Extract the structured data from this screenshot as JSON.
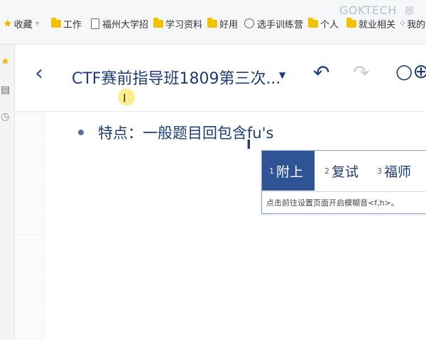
{
  "bookmarks": {
    "items": [
      {
        "label": "收藏",
        "icon": "star-icon"
      },
      {
        "label": "工作",
        "icon": "folder-icon"
      },
      {
        "label": "福州大学招",
        "icon": "page-icon"
      },
      {
        "label": "学习资料",
        "icon": "folder-icon"
      },
      {
        "label": "好用",
        "icon": "folder-icon"
      },
      {
        "label": "选手训练营",
        "icon": "circle-icon"
      },
      {
        "label": "个人",
        "icon": "folder-icon"
      },
      {
        "label": "就业相关",
        "icon": "folder-icon"
      },
      {
        "label": "我的",
        "icon": "dots-icon"
      }
    ],
    "watermark": "GOKTECH",
    "watermark_extra": "部"
  },
  "sidebar": {
    "icons": [
      "star-icon",
      "notebook-icon",
      "clock-icon"
    ]
  },
  "toolbar": {
    "back_symbol": "‹",
    "title": "CTF赛前指导班1809第三次...",
    "dropdown_symbol": "▼",
    "undo_symbol": "↶",
    "redo_symbol": "↷",
    "more_symbol": "○⊕"
  },
  "content": {
    "line": "特点：一般题目回包含fu's",
    "cursor_symbol": "I"
  },
  "ime": {
    "candidates": [
      {
        "num": "1",
        "text": "附上"
      },
      {
        "num": "2",
        "text": "复试"
      },
      {
        "num": "3",
        "text": "福师"
      }
    ],
    "hint": "点击前往设置页面开启模糊音<f,h>。"
  },
  "colors": {
    "accent": "#2f5496",
    "title": "#1e3c78",
    "folder": "#f2c200"
  }
}
